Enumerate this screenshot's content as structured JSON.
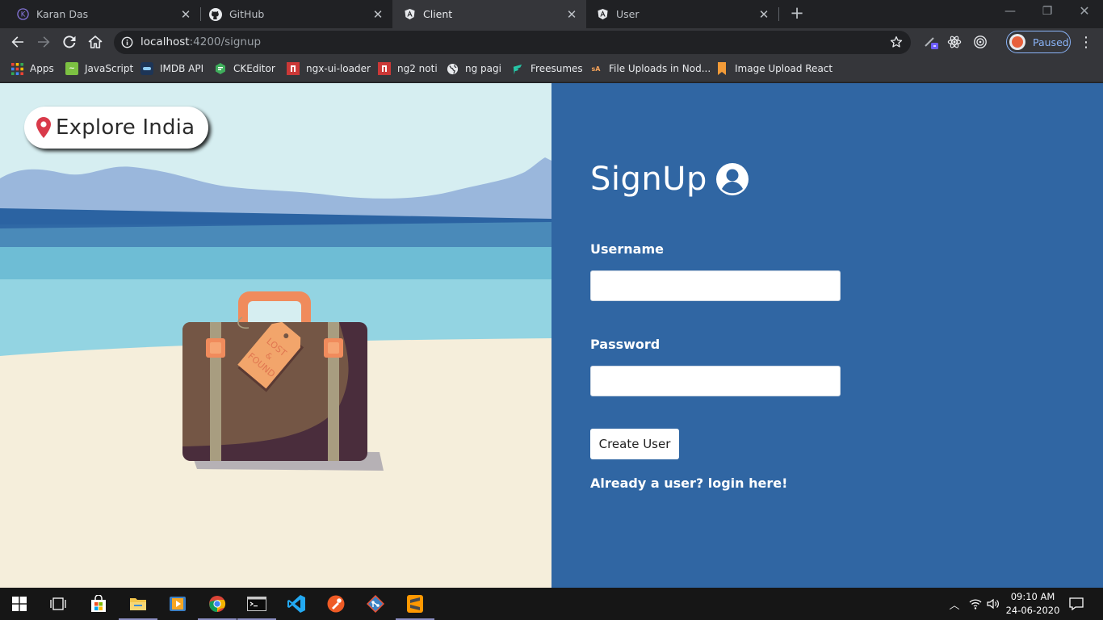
{
  "browser": {
    "tabs": [
      {
        "title": "Karan Das",
        "icon": "karan-das-favicon",
        "active": false
      },
      {
        "title": "GitHub",
        "icon": "github-icon",
        "active": false
      },
      {
        "title": "Client",
        "icon": "angular-icon",
        "active": true
      },
      {
        "title": "User",
        "icon": "angular-icon",
        "active": false
      }
    ],
    "url_host": "localhost",
    "url_path": ":4200/signup",
    "profile_status": "Paused"
  },
  "bookmarks": [
    {
      "label": "Apps",
      "icon": "apps-grid-icon"
    },
    {
      "label": "JavaScript",
      "icon": "javascript-bookmark-icon"
    },
    {
      "label": "IMDB API",
      "icon": "imdb-api-icon"
    },
    {
      "label": "CKEditor",
      "icon": "ckeditor-icon"
    },
    {
      "label": "ngx-ui-loader",
      "icon": "npm-icon"
    },
    {
      "label": "ng2 noti",
      "icon": "npm-icon"
    },
    {
      "label": "ng pagi",
      "icon": "globe-icon"
    },
    {
      "label": "Freesumes",
      "icon": "freesumes-icon"
    },
    {
      "label": "File Uploads in Nod...",
      "icon": "sa-icon"
    },
    {
      "label": "Image Upload React",
      "icon": "bookmark-ribbon-icon"
    }
  ],
  "page": {
    "brand": "Explore India",
    "heading": "SignUp",
    "username_label": "Username",
    "username_value": "",
    "password_label": "Password",
    "password_value": "",
    "submit_label": "Create User",
    "login_link": "Already a user? login here!",
    "luggage_tag": "LOST & FOUND"
  },
  "taskbar": {
    "apps": [
      "start-icon",
      "task-view-icon",
      "store-icon",
      "file-explorer-icon",
      "media-player-icon",
      "chrome-icon",
      "terminal-icon",
      "vscode-icon",
      "postman-icon",
      "git-icon",
      "sublime-text-icon"
    ],
    "time": "09:10 AM",
    "date": "24-06-2020"
  },
  "colors": {
    "panel_blue": "#3066a3",
    "sand": "#f5eedb",
    "sky": "#d6eef1"
  }
}
